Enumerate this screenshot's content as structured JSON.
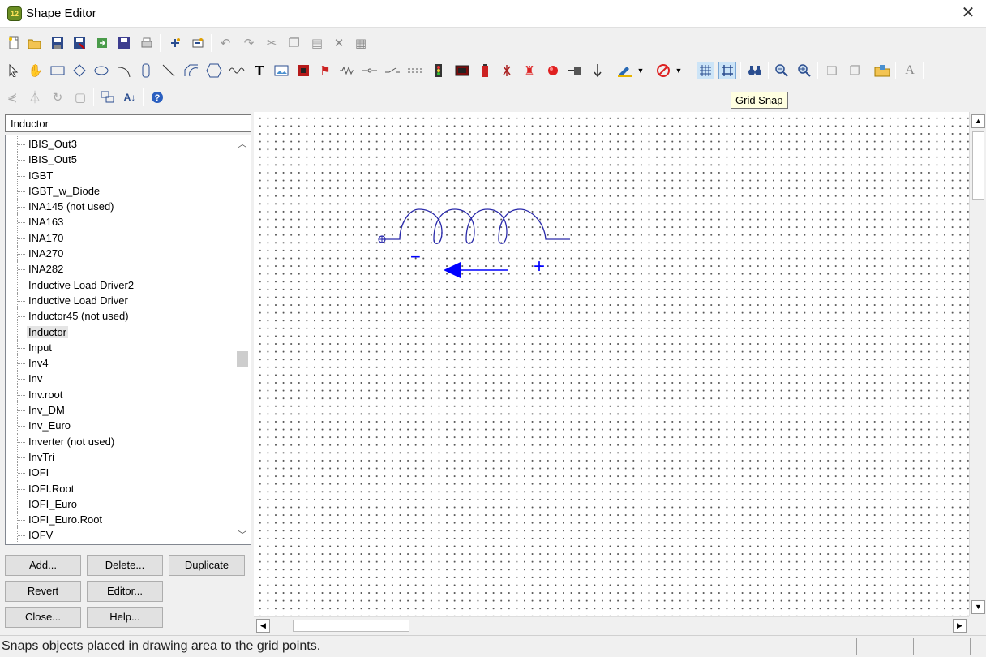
{
  "window": {
    "title": "Shape Editor",
    "app_icon_text": "12",
    "close_glyph": "✕"
  },
  "tooltip": "Grid Snap",
  "search": {
    "value": "Inductor"
  },
  "tree": {
    "items": [
      "IBIS_Out3",
      "IBIS_Out5",
      "IGBT",
      "IGBT_w_Diode",
      "INA145 (not used)",
      "INA163",
      "INA170",
      "INA270",
      "INA282",
      "Inductive Load Driver2",
      "Inductive Load Driver",
      "Inductor45 (not used)",
      "Inductor",
      "Input",
      "Inv4",
      "Inv",
      "Inv.root",
      "Inv_DM",
      "Inv_Euro",
      "Inverter (not used)",
      "InvTri",
      "IOFI",
      "IOFI.Root",
      "IOFI_Euro",
      "IOFI_Euro.Root",
      "IOFV"
    ],
    "selected": "Inductor"
  },
  "buttons": {
    "add": "Add...",
    "delete": "Delete...",
    "duplicate": "Duplicate",
    "revert": "Revert",
    "editor": "Editor...",
    "close": "Close...",
    "help": "Help..."
  },
  "canvas": {
    "shape_name": "Inductor",
    "minus_label": "−",
    "plus_label": "+",
    "shape_color": "#0000ff",
    "grid": true
  },
  "toolbar_icons": {
    "row1": [
      "new-icon",
      "open-icon",
      "save-icon",
      "save-as-icon",
      "export-icon",
      "save-all-icon",
      "print-icon",
      "add-pin-icon",
      "add-pin-box-icon",
      "undo-icon",
      "redo-icon",
      "cut-icon",
      "copy-icon",
      "paste-icon",
      "delete-icon",
      "properties-icon"
    ],
    "row2": [
      "select-icon",
      "pan-icon",
      "rectangle-icon",
      "diamond-icon",
      "ellipse-icon",
      "arc-icon",
      "rounded-rect-icon",
      "line-icon",
      "polygon-icon",
      "hexagon-icon",
      "wave-icon",
      "text-icon",
      "image-icon"
    ],
    "row2_toggle_active": "grid-snap-icon"
  },
  "status": {
    "message": "Snaps objects placed in drawing area to the grid points."
  },
  "colors": {
    "accent_blue": "#0000ff",
    "selection": "#cce4f7",
    "tooltip_bg": "#ffffe1"
  }
}
